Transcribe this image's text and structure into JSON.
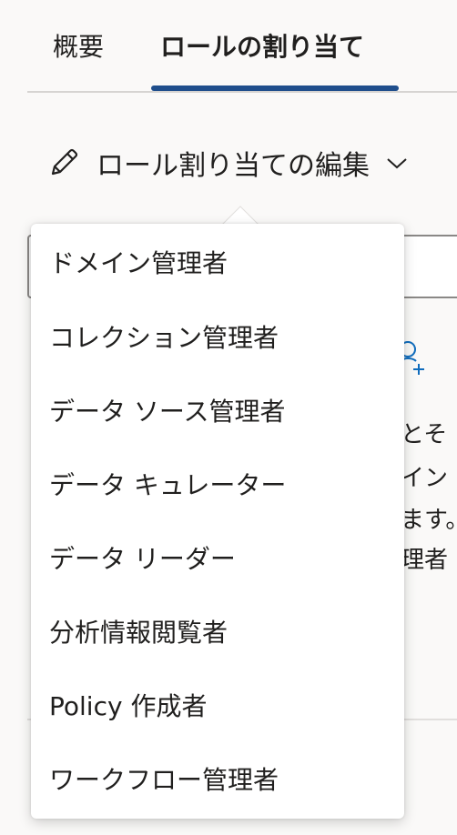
{
  "tabs": [
    {
      "label": "概要"
    },
    {
      "label": "ロールの割り当て"
    }
  ],
  "edit_menu": {
    "label": "ロール割り当ての編集",
    "icon": "pencil-icon",
    "chevron": "chevron-down-icon"
  },
  "background_text": {
    "line1": "とそ",
    "line2": "イン",
    "line3": "ます。",
    "line4": "理者"
  },
  "dropdown": {
    "items": [
      {
        "label": "ドメイン管理者"
      },
      {
        "label": "コレクション管理者"
      },
      {
        "label": "データ ソース管理者"
      },
      {
        "label": "データ キュレーター"
      },
      {
        "label": "データ リーダー"
      },
      {
        "label": "分析情報閲覧者"
      },
      {
        "label": "Policy 作成者"
      },
      {
        "label": "ワークフロー管理者"
      }
    ]
  },
  "colors": {
    "accent": "#1f4e8c",
    "icon_blue": "#0f6cbd",
    "text": "#201f1e",
    "background": "#faf9f8"
  }
}
